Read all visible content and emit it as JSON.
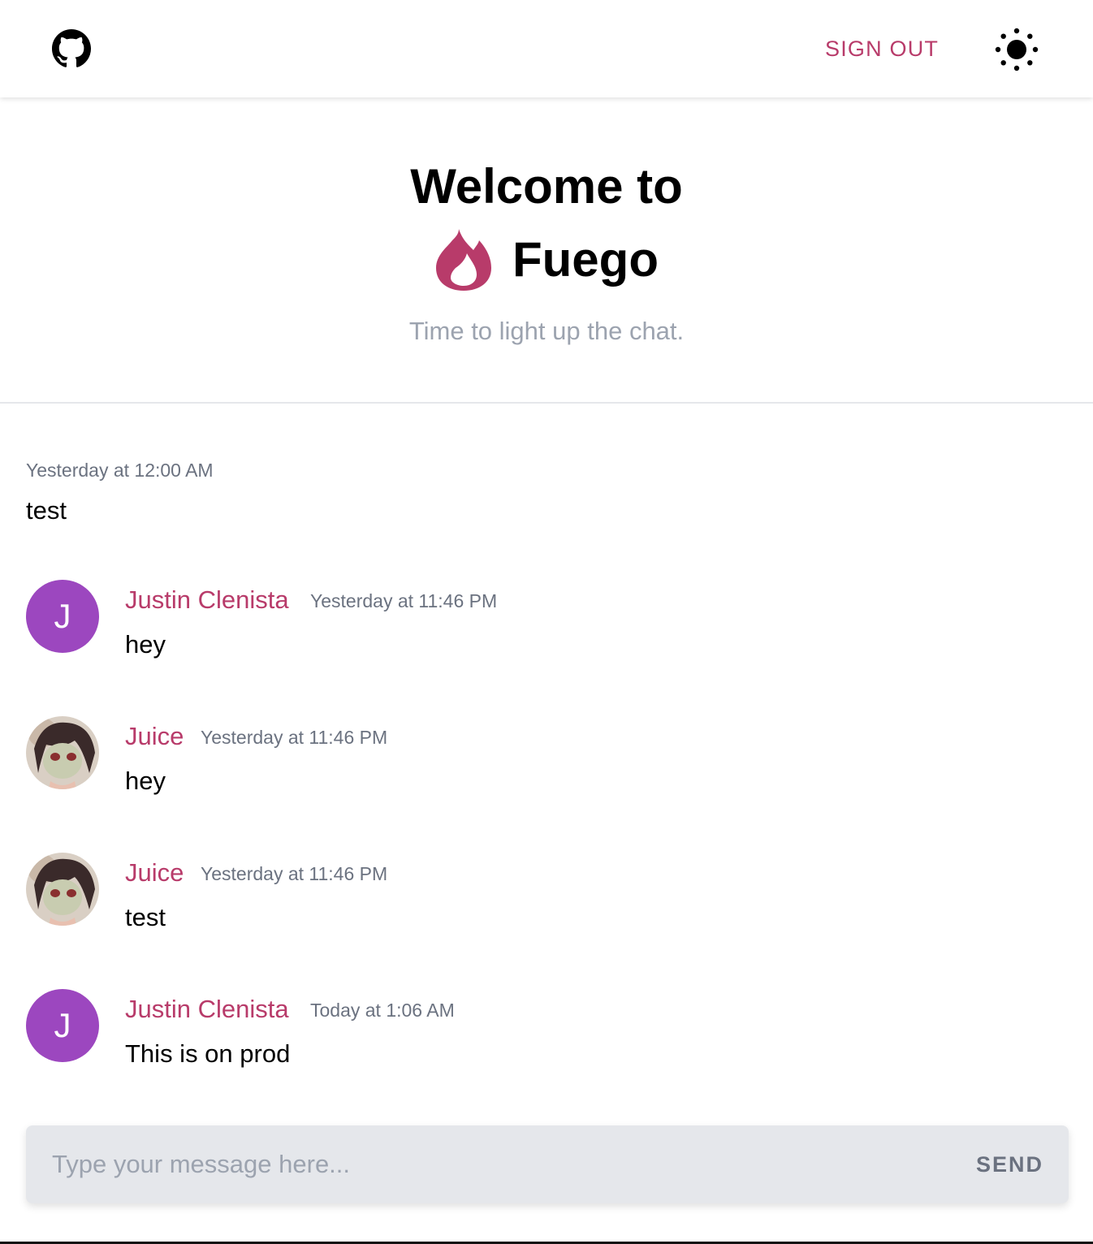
{
  "colors": {
    "accent": "#b83b6a",
    "avatar_purple": "#9c47bf",
    "muted": "#6b7280",
    "placeholder": "#9ca3af"
  },
  "header": {
    "github_icon": "github-icon",
    "signout_label": "SIGN OUT",
    "theme_icon": "sun-icon"
  },
  "hero": {
    "title": "Welcome to",
    "brand_icon": "flame-icon",
    "brand_name": "Fuego",
    "subtitle": "Time to light up the chat."
  },
  "messages": [
    {
      "time": "Yesterday at 12:00 AM",
      "text": "test"
    },
    {
      "author": "Justin Clenista",
      "avatar": "J",
      "time": "Yesterday at 11:46 PM",
      "text": "hey"
    },
    {
      "author": "Juice",
      "avatar_icon": "anime-avatar-image",
      "time": "Yesterday at 11:46 PM",
      "text": "hey"
    },
    {
      "author": "Juice",
      "avatar_icon": "anime-avatar-image",
      "time": "Yesterday at 11:46 PM",
      "text": "test"
    },
    {
      "author": "Justin Clenista",
      "avatar": "J",
      "time": "Today at 1:06 AM",
      "text": "This is on prod"
    }
  ],
  "composer": {
    "placeholder": "Type your message here...",
    "send_label": "SEND"
  }
}
